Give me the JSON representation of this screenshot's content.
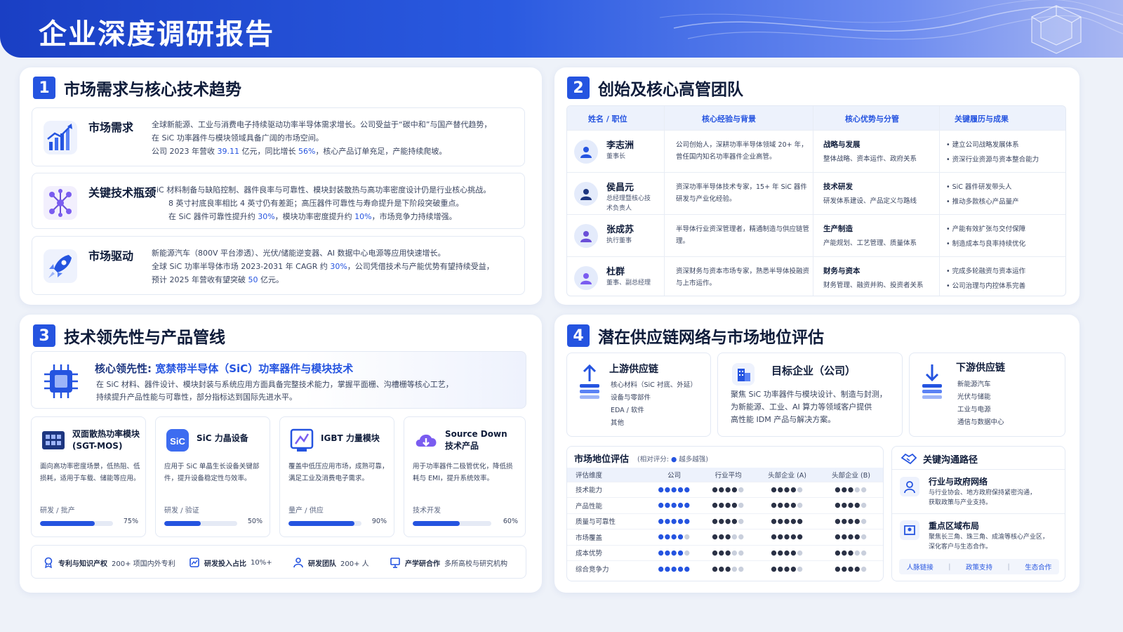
{
  "header": {
    "title": "企业深度调研报告"
  },
  "colors": {
    "accent": "#2554e0",
    "header_gradient_start": "#1a3fc4",
    "header_gradient_end": "#aab8f2"
  },
  "section1": {
    "num": "1",
    "title": "市场需求与核心技术趋势",
    "cards": [
      {
        "icon": "chart-up-icon",
        "title": "市场需求",
        "lines": [
          [
            {
              "t": "全球新能源、工业与消费电子持续驱动功率半导体需求增长。公司受益于“碳中和”与国产替代趋势，"
            }
          ],
          [
            {
              "t": "在 SiC 功率器件与模块领域具备广阔的市场空间。"
            }
          ],
          [
            {
              "t": "公司 2023 年营收 "
            },
            {
              "t": "39.11",
              "h": true
            },
            {
              "t": " 亿元，同比增长 "
            },
            {
              "t": "56%",
              "h": true
            },
            {
              "t": "，核心产品订单充足，产能持续爬坡。"
            }
          ]
        ]
      },
      {
        "icon": "molecule-icon",
        "title": "关键技术瓶颈",
        "lines": [
          [
            {
              "t": "SiC 材料制备与缺陷控制、器件良率与可靠性、模块封装散热与高功率密度设计仍是行业核心挑战。"
            }
          ],
          [
            {
              "t": "8 英寸衬底良率相比 4 英寸仍有差距；高压器件可靠性与寿命提升是下阶段突破重点。"
            }
          ],
          [
            {
              "t": "在 SiC 器件可靠性提升约 "
            },
            {
              "t": "30%",
              "h": true
            },
            {
              "t": "，模块功率密度提升约 "
            },
            {
              "t": "10%",
              "h": true
            },
            {
              "t": "，市场竞争力持续增强。"
            }
          ]
        ]
      },
      {
        "icon": "rocket-icon",
        "title": "市场驱动",
        "lines": [
          [
            {
              "t": "新能源汽车（800V 平台渗透）、光伏/储能逆变器、AI 数据中心电源等应用快速增长。"
            }
          ],
          [
            {
              "t": "全球 SiC 功率半导体市场 2023-2031 年 CAGR 约 "
            },
            {
              "t": "30%",
              "h": true
            },
            {
              "t": "，公司凭借技术与产能优势有望持续受益，"
            }
          ],
          [
            {
              "t": "预计 2025 年营收有望突破 "
            },
            {
              "t": "50",
              "h": true
            },
            {
              "t": " 亿元。"
            }
          ]
        ]
      }
    ]
  },
  "section2": {
    "num": "2",
    "title": "创始及核心高管团队",
    "headers": [
      "姓名 / 职位",
      "核心经验与背景",
      "核心优势与分管",
      "关键履历与成果"
    ],
    "rows": [
      {
        "name": "李志洲",
        "role": "董事长",
        "bg": "公司创始人，深耕功率半导体领域 20+ 年，曾任国内知名功率器件企业高管。",
        "st_title": "战略与发展",
        "st": "整体战略、资本运作、政府关系",
        "ms": [
          "建立公司战略发展体系",
          "资深行业资源与资本整合能力"
        ]
      },
      {
        "name": "侯昌元",
        "role": "总经理暨核心技术负责人",
        "bg": "资深功率半导体技术专家，15+ 年 SiC 器件研发与产业化经验。",
        "st_title": "技术研发",
        "st": "研发体系建设、产品定义与路线",
        "ms": [
          "SiC 器件研发带头人",
          "推动多款核心产品量产"
        ]
      },
      {
        "name": "张成苏",
        "role": "执行董事",
        "bg": "半导体行业资深管理者，精通制造与供应链管理。",
        "st_title": "生产制造",
        "st": "产能规划、工艺管理、质量体系",
        "ms": [
          "产能有效扩张与交付保障",
          "制造成本与良率持续优化"
        ]
      },
      {
        "name": "杜群",
        "role": "董事、副总经理",
        "bg": "资深财务与资本市场专家，熟悉半导体投融资与上市运作。",
        "st_title": "财务与资本",
        "st": "财务管理、融资并购、投资者关系",
        "ms": [
          "完成多轮融资与资本运作",
          "公司治理与内控体系完善"
        ]
      }
    ]
  },
  "section3": {
    "num": "3",
    "title": "技术领先性与产品管线",
    "core_label": "核心领先性:",
    "core_title": "宽禁带半导体（SiC）功率器件与模块技术",
    "core_desc": [
      "在 SiC 材料、器件设计、模块封装与系统应用方面具备完整技术能力，掌握平面栅、沟槽栅等核心工艺，",
      "持续提升产品性能与可靠性，部分指标达到国际先进水平。"
    ],
    "products": [
      {
        "icon": "module-icon",
        "name": "双面散热功率模块 (SGT-MOS)",
        "desc": "面向高功率密度场景，低热阻、低损耗，适用于车载、储能等应用。",
        "stage": "研发 / 批产",
        "progress": 0.75,
        "pct": "75%"
      },
      {
        "icon": "sic-icon",
        "name": "SiC 力晶设备",
        "desc": "应用于 SiC 单晶生长设备关键部件，提升设备稳定性与效率。",
        "stage": "研发 / 验证",
        "progress": 0.5,
        "pct": "50%"
      },
      {
        "icon": "igbt-icon",
        "name": "IGBT 力量模块",
        "desc": "覆盖中低压应用市场，成熟可靠，满足工业及消费电子需求。",
        "stage": "量产 / 供应",
        "progress": 0.9,
        "pct": "90%"
      },
      {
        "icon": "cloud-down-icon",
        "name": "Source Down 技术产品",
        "desc": "用于功率器件二极管优化，降低损耗与 EMI，提升系统效率。",
        "stage": "技术开发",
        "progress": 0.6,
        "pct": "60%"
      }
    ],
    "stats": [
      {
        "icon": "award-icon",
        "label": "专利与知识产权",
        "value": "200+ 项国内外专利"
      },
      {
        "icon": "invest-icon",
        "label": "研发投入占比",
        "value": "10%+"
      },
      {
        "icon": "team-icon",
        "label": "研发团队",
        "value": "200+ 人"
      },
      {
        "icon": "presentation-icon",
        "label": "产学研合作",
        "value": "多所高校与研究机构"
      }
    ]
  },
  "section4": {
    "num": "4",
    "title": "潜在供应链网络与市场地位评估",
    "upstream": {
      "icon": "upload-icon",
      "title": "上游供应链",
      "items": [
        "核心材料（SiC 衬底、外延）",
        "设备与零部件",
        "EDA / 软件",
        "其他"
      ]
    },
    "target": {
      "icon": "building-icon",
      "title": "目标企业（公司）",
      "lines": [
        "聚焦 SiC 功率器件与模块设计、制造与封测，",
        "为新能源、工业、AI 算力等领域客户提供",
        "高性能 IDM 产品与解决方案。"
      ]
    },
    "downstream": {
      "icon": "download-icon",
      "title": "下游供应链",
      "items": [
        "新能源汽车",
        "光伏与储能",
        "工业与电源",
        "通信与数据中心"
      ]
    },
    "market": {
      "title": "市场地位评估",
      "note": "(相对评分:",
      "note2": "越多越强)",
      "headers": [
        "评估维度",
        "公司",
        "行业平均",
        "头部企业 (A)",
        "头部企业 (B)"
      ],
      "rows": [
        {
          "dim": "技术能力",
          "scores": [
            5,
            4,
            4,
            3
          ]
        },
        {
          "dim": "产品性能",
          "scores": [
            5,
            4,
            4,
            4
          ]
        },
        {
          "dim": "质量与可靠性",
          "scores": [
            5,
            4,
            5,
            4
          ]
        },
        {
          "dim": "市场覆盖",
          "scores": [
            4,
            3,
            5,
            4
          ]
        },
        {
          "dim": "成本优势",
          "scores": [
            4,
            3,
            4,
            3
          ]
        },
        {
          "dim": "综合竞争力",
          "scores": [
            5,
            3,
            4,
            4
          ]
        }
      ]
    },
    "comm": {
      "title": "关键沟通路径",
      "items": [
        {
          "icon": "person-icon",
          "title": "行业与政府网络",
          "desc": [
            "与行业协会、地方政府保持紧密沟通，",
            "获取政策与产业支持。"
          ]
        },
        {
          "icon": "region-icon",
          "title": "重点区域布局",
          "desc": [
            "聚焦长三角、珠三角、成渝等核心产业区，",
            "深化客户与生态合作。"
          ]
        }
      ],
      "tags": [
        "人脉链接",
        "政策支持",
        "生态合作"
      ]
    }
  }
}
